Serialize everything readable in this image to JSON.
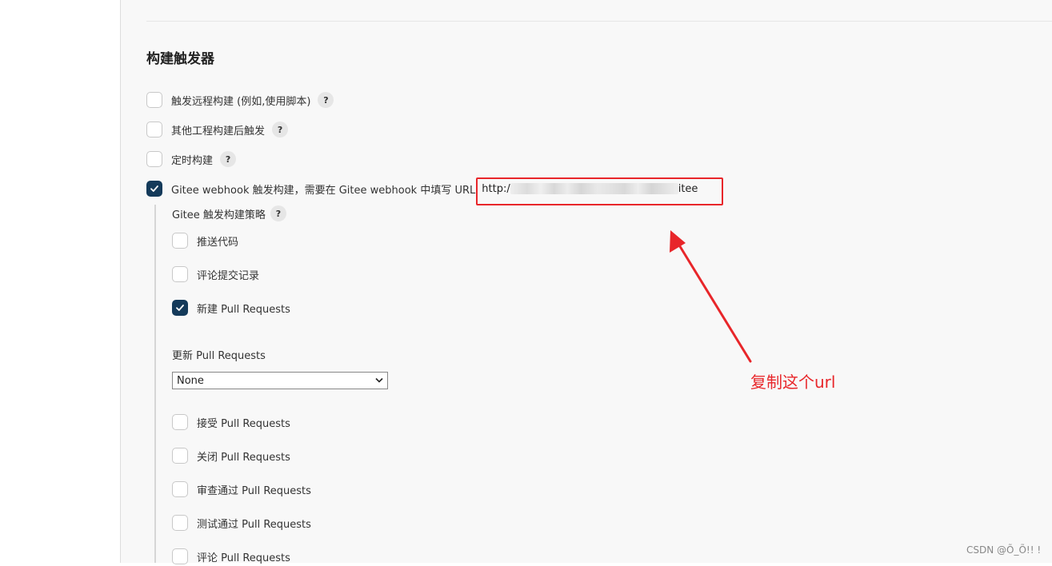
{
  "section": {
    "title": "构建触发器"
  },
  "triggers": [
    {
      "label": "触发远程构建 (例如,使用脚本)",
      "checked": false,
      "help": "?"
    },
    {
      "label": "其他工程构建后触发",
      "checked": false,
      "help": "?"
    },
    {
      "label": "定时构建",
      "checked": false,
      "help": "?"
    },
    {
      "label": "Gitee webhook 触发构建，需要在 Gitee webhook 中填写 URL",
      "checked": true,
      "url_prefix": "http:/",
      "url_suffix": "itee"
    }
  ],
  "gitee": {
    "strategy_label": "Gitee 触发构建策略",
    "strategy_help": "?",
    "strategies": [
      {
        "label": "推送代码",
        "checked": false
      },
      {
        "label": "评论提交记录",
        "checked": false
      },
      {
        "label": "新建 Pull Requests",
        "checked": true
      }
    ],
    "update_label": "更新 Pull Requests",
    "update_value": "None",
    "pr_actions": [
      {
        "label": "接受 Pull Requests",
        "checked": false
      },
      {
        "label": "关闭 Pull Requests",
        "checked": false
      },
      {
        "label": "审查通过 Pull Requests",
        "checked": false
      },
      {
        "label": "测试通过 Pull Requests",
        "checked": false
      },
      {
        "label": "评论 Pull Requests",
        "checked": false
      }
    ]
  },
  "annotation": {
    "text": "复制这个url",
    "color": "#e8262a"
  },
  "watermark": "CSDN @Õ_Õ!! !",
  "colors": {
    "checkbox_checked": "#143a5a",
    "annotation_red": "#e8262a"
  }
}
